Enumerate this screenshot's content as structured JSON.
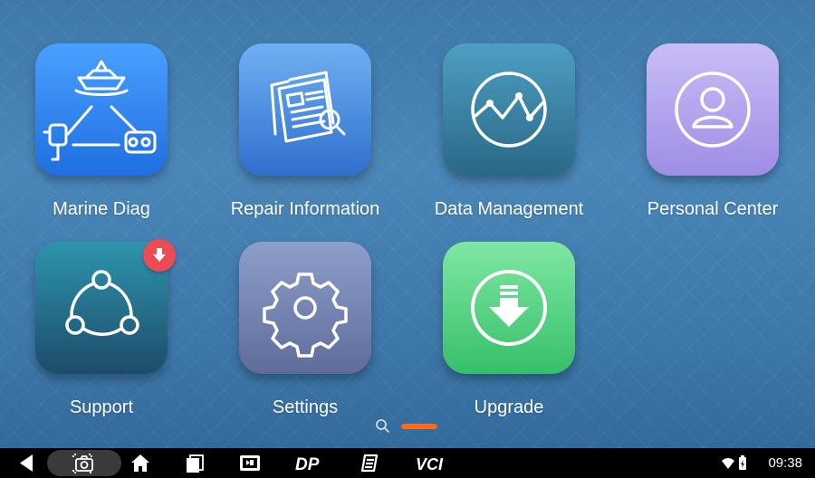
{
  "apps": [
    {
      "label": "Marine Diag",
      "icon": "marine-diag-icon"
    },
    {
      "label": "Repair Information",
      "icon": "repair-document-icon"
    },
    {
      "label": "Data Management",
      "icon": "waveform-chart-icon"
    },
    {
      "label": "Personal Center",
      "icon": "user-profile-icon"
    },
    {
      "label": "Support",
      "icon": "share-network-icon"
    },
    {
      "label": "Settings",
      "icon": "gear-icon"
    },
    {
      "label": "Upgrade",
      "icon": "download-circle-icon"
    }
  ],
  "colors": {
    "marine": [
      "#4aa0ff",
      "#1f6fe0"
    ],
    "repair": [
      "#6fb0f3",
      "#2f6fce"
    ],
    "data": [
      "#4d9fc3",
      "#2a6886"
    ],
    "personal": [
      "#c9bdf6",
      "#9e8ee6"
    ],
    "support": [
      "#2e95ad",
      "#1d4b6a"
    ],
    "settings": [
      "#8e9ecb",
      "#5f6c99"
    ],
    "upgrade": [
      "#7fe7a3",
      "#36c06a"
    ],
    "badge": "#ef4b55",
    "pager_active": "#ff6a1a"
  },
  "taskbar": {
    "icons": [
      "back-icon",
      "camera-icon",
      "home-icon",
      "recent-apps-icon",
      "tablet-app-icon",
      "dp-logo-icon",
      "notes-icon",
      "vci-logo-icon"
    ],
    "dp_text": "DP",
    "vci_text": "VCI"
  },
  "status": {
    "time": "09:38",
    "icons": [
      "wifi-icon",
      "battery-icon"
    ]
  }
}
